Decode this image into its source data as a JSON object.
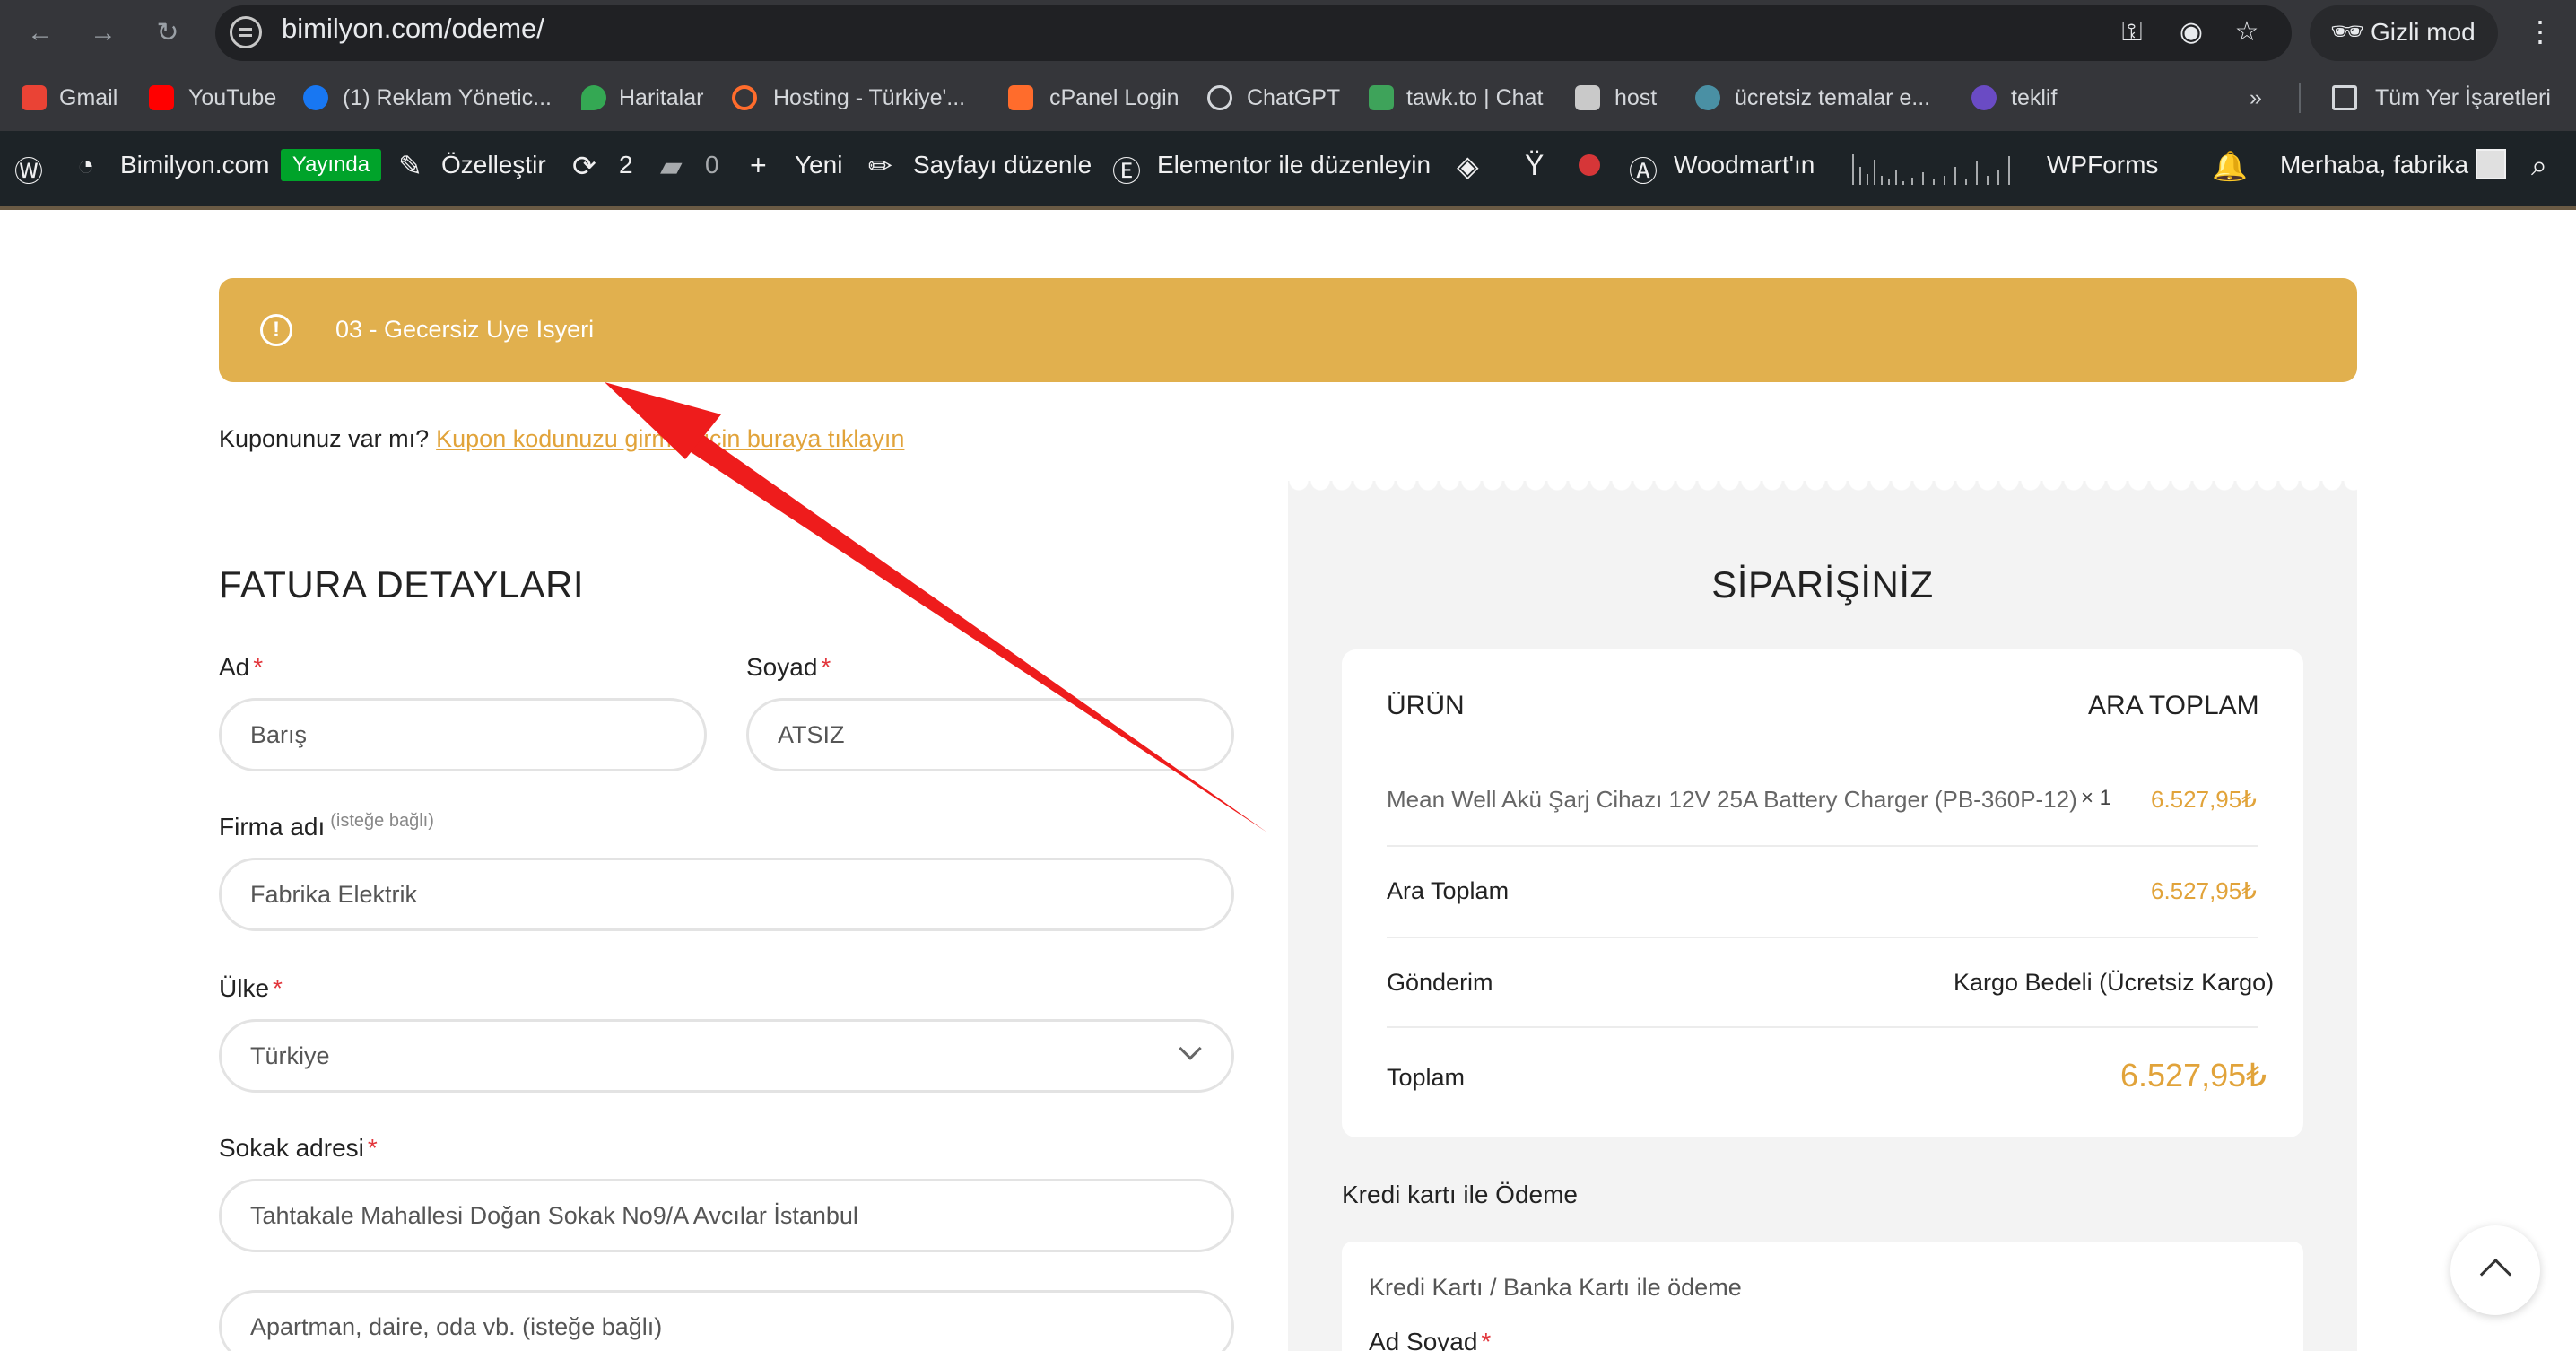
{
  "browser": {
    "url": "bimilyon.com/odeme/",
    "incognito_label": "Gizli mod",
    "bookmarks": [
      "Gmail",
      "YouTube",
      "(1) Reklam Yönetic...",
      "Haritalar",
      "Hosting - Türkiye'...",
      "cPanel Login",
      "ChatGPT",
      "tawk.to | Chat",
      "host",
      "ücretsiz temalar e...",
      "teklif"
    ],
    "all_bookmarks": "Tüm Yer İşaretleri",
    "more": "»"
  },
  "adminbar": {
    "site": "Bimilyon.com",
    "live": "Yayında",
    "customize": "Özelleştir",
    "updates": "2",
    "comments": "0",
    "new": "Yeni",
    "edit_page": "Sayfayı düzenle",
    "elementor": "Elementor ile düzenleyin",
    "woodmart": "Woodmart'ın",
    "wpforms": "WPForms",
    "greeting": "Merhaba, fabrika"
  },
  "notice": {
    "text": "03 - Gecersiz Uye Isyeri",
    "color": "#e1b04e"
  },
  "coupon": {
    "question": "Kuponunuz var mı?",
    "link": "Kupon kodunuzu girmek için buraya tıklayın"
  },
  "billing": {
    "title": "FATURA DETAYLARI",
    "first_name_label": "Ad",
    "first_name": "Barış",
    "last_name_label": "Soyad",
    "last_name": "ATSIZ",
    "company_label": "Firma adı",
    "optional": "(isteğe bağlı)",
    "company": "Fabrika Elektrik",
    "country_label": "Ülke",
    "country": "Türkiye",
    "street_label": "Sokak adresi",
    "street": "Tahtakale Mahallesi Doğan Sokak No9/A Avcılar İstanbul",
    "street2_placeholder": "Apartman, daire, oda vb. (isteğe bağlı)",
    "required_mark": "*"
  },
  "order": {
    "title": "SİPARİŞİNİZ",
    "col_product": "ÜRÜN",
    "col_subtotal": "ARA TOPLAM",
    "product": "Mean Well Akü Şarj Cihazı 12V 25A Battery Charger (PB-360P-12)",
    "qty": "× 1",
    "product_price": "6.527,95₺",
    "subtotal_label": "Ara Toplam",
    "subtotal": "6.527,95₺",
    "shipping_label": "Gönderim",
    "shipping": "Kargo Bedeli (Ücretsiz Kargo)",
    "total_label": "Toplam",
    "total": "6.527,95₺"
  },
  "payment": {
    "title": "Kredi kartı ile Ödeme",
    "subtitle": "Kredi Kartı / Banka Kartı ile ödeme",
    "name_label": "Ad Soyad"
  },
  "colors": {
    "accent": "#e1b04e",
    "price": "#e1a33a",
    "annotation_arrow": "#ee1c1c",
    "adminbar": "#1d2327"
  }
}
